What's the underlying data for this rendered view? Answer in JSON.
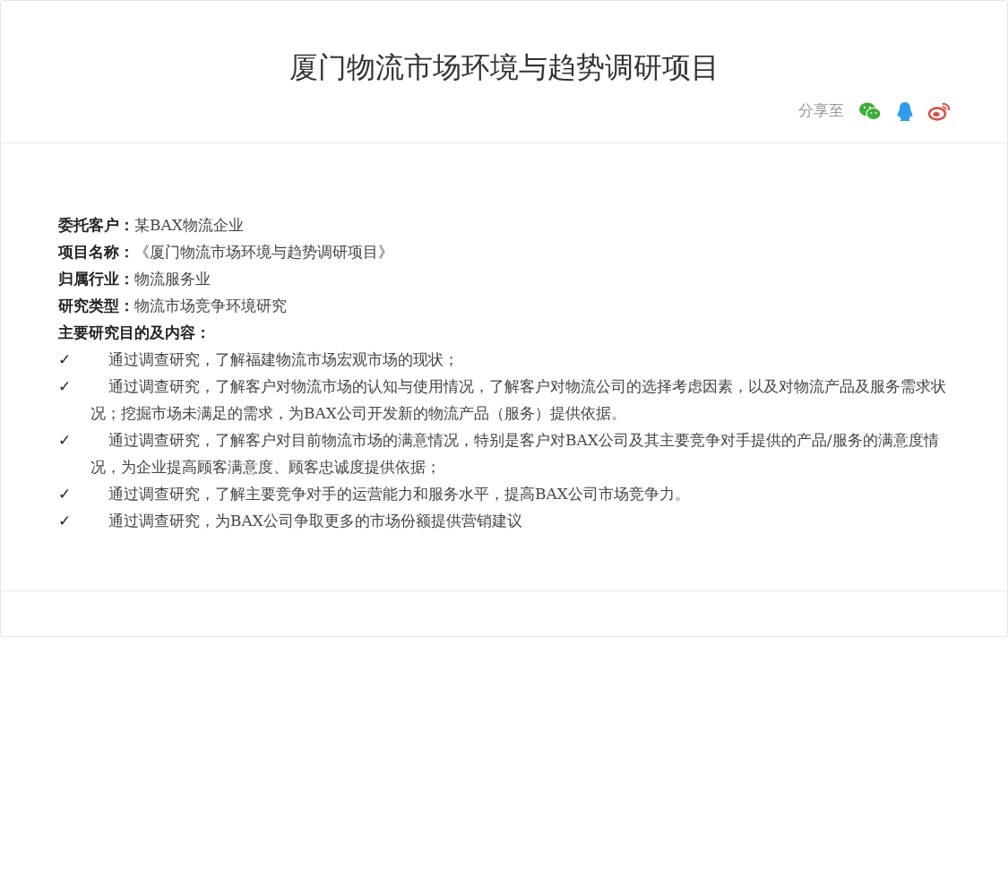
{
  "title": "厦门物流市场环境与趋势调研项目",
  "share": {
    "label": "分享至",
    "icons": [
      {
        "kind": "wechat"
      },
      {
        "kind": "qq"
      },
      {
        "kind": "weibo"
      }
    ]
  },
  "fields": [
    {
      "label": "委托客户：",
      "value": "某BAX物流企业"
    },
    {
      "label": "项目名称：",
      "value": "《厦门物流市场环境与趋势调研项目》"
    },
    {
      "label": "归属行业：",
      "value": "物流服务业"
    },
    {
      "label": "研究类型：",
      "value": "物流市场竞争环境研究"
    },
    {
      "label": "主要研究目的及内容："
    }
  ],
  "objectives": [
    {
      "mark": "✓",
      "text": "通过调查研究，了解福建物流市场宏观市场的现状；"
    },
    {
      "mark": "✓",
      "text": "通过调查研究，了解客户对物流市场的认知与使用情况，了解客户对物流公司的选择考虑因素，以及对物流产品及服务需求状况；挖掘市场未满足的需求，为BAX公司开发新的物流产品（服务）提供依据。"
    },
    {
      "mark": "✓",
      "text": "通过调查研究，了解客户对目前物流市场的满意情况，特别是客户对BAX公司及其主要竞争对手提供的产品/服务的满意度情况，为企业提高顾客满意度、顾客忠诚度提供依据；"
    },
    {
      "mark": "✓",
      "text": "通过调查研究，了解主要竞争对手的运营能力和服务水平，提高BAX公司市场竞争力。"
    },
    {
      "mark": "✓",
      "text": "通过调查研究，为BAX公司争取更多的市场份额提供营销建议"
    }
  ]
}
